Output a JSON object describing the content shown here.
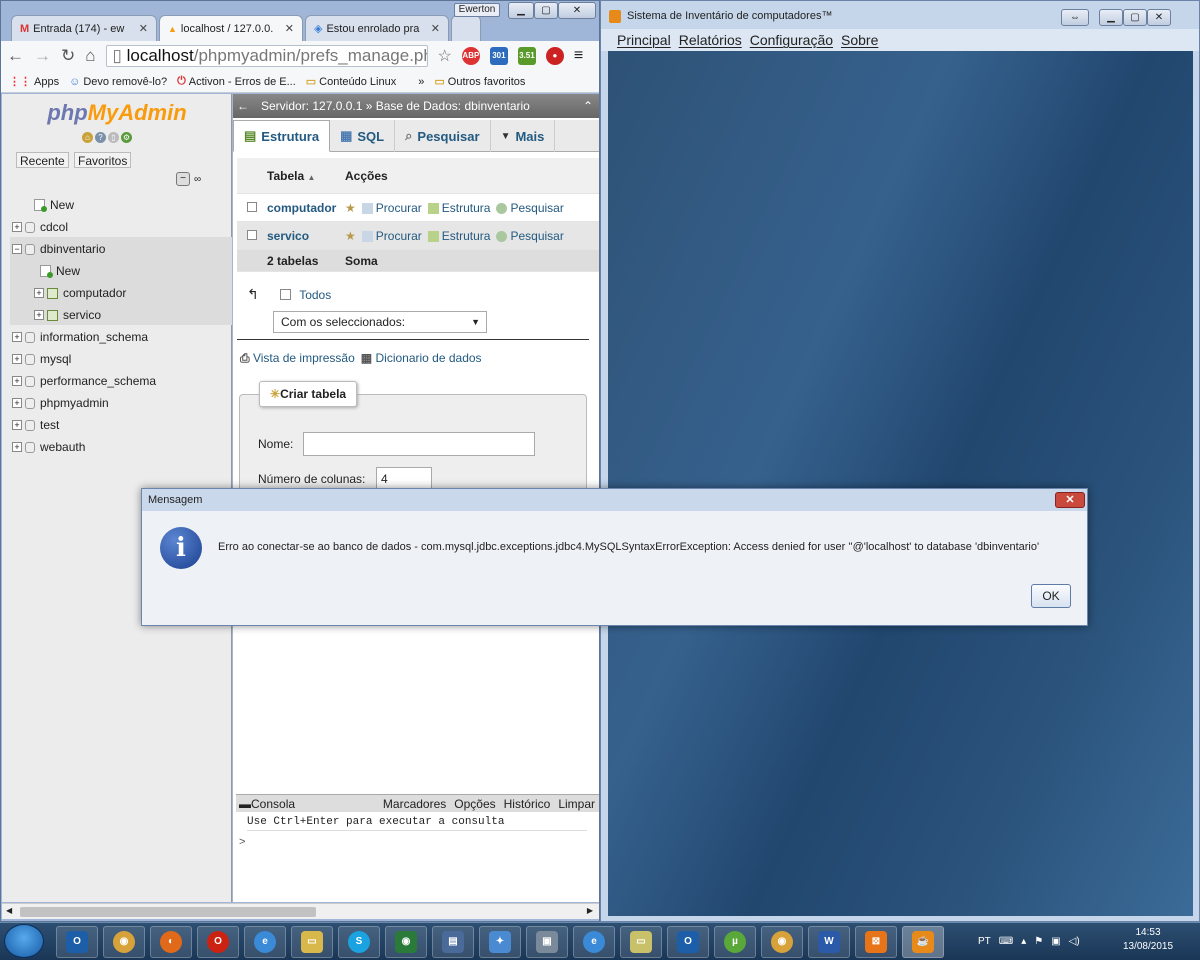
{
  "chrome": {
    "tabs": [
      "Entrada (174) - ew",
      "localhost / 127.0.0.",
      "Estou enrolado pra"
    ],
    "user": "Ewerton",
    "url_host": "localhost",
    "url_path": "/phpmyadmin/prefs_manage.ph",
    "ext_abp": "ABP",
    "ext_1": "301",
    "ext_2": "3.51",
    "bookmarks": [
      "Apps",
      "Devo removê-lo?",
      "Activon - Erros de E...",
      "Conteúdo Linux",
      "»",
      "Outros favoritos"
    ]
  },
  "pma": {
    "logo_php": "php",
    "logo_my": "MyAdmin",
    "recent": "Recente",
    "favorites": "Favoritos",
    "tree": [
      "New",
      "cdcol",
      "dbinventario",
      "New",
      "computador",
      "servico",
      "information_schema",
      "mysql",
      "performance_schema",
      "phpmyadmin",
      "test",
      "webauth"
    ],
    "breadcrumb": "Servidor: 127.0.0.1 » Base de Dados: dbinventario",
    "tabs": [
      "Estrutura",
      "SQL",
      "Pesquisar",
      "Mais"
    ],
    "col_table": "Tabela",
    "col_actions": "Acções",
    "rows": [
      {
        "name": "computador",
        "a1": "Procurar",
        "a2": "Estrutura",
        "a3": "Pesquisar"
      },
      {
        "name": "servico",
        "a1": "Procurar",
        "a2": "Estrutura",
        "a3": "Pesquisar"
      }
    ],
    "footer_count": "2 tabelas",
    "footer_sum": "Soma",
    "all_label": "Todos",
    "with_selected": "Com os seleccionados:",
    "print_view": "Vista de impressão",
    "data_dict": "Dicionario de dados",
    "create_table": "Criar tabela",
    "name_label": "Nome:",
    "columns_label": "Número de colunas:",
    "columns_value": "4",
    "console": [
      "Consola",
      "Marcadores",
      "Opções",
      "Histórico",
      "Limpar"
    ],
    "console_hint": "Use Ctrl+Enter para executar a consulta",
    "console_prompt": ">"
  },
  "java": {
    "title": "Sistema de Inventário de computadores™",
    "menu": [
      "Principal",
      "Relatórios",
      "Configuração",
      "Sobre"
    ]
  },
  "dialog": {
    "title": "Mensagem",
    "message": "Erro ao conectar-se ao banco de dados - com.mysql.jdbc.exceptions.jdbc4.MySQLSyntaxErrorException: Access denied for user ''@'localhost' to database 'dbinventario'",
    "ok": "OK"
  },
  "taskbar": {
    "lang": "PT",
    "time": "14:53",
    "date": "13/08/2015"
  },
  "colors": {
    "pma_link": "#235a81",
    "pma_orange": "#f89c0e",
    "dialog_close": "#c94a3c"
  }
}
